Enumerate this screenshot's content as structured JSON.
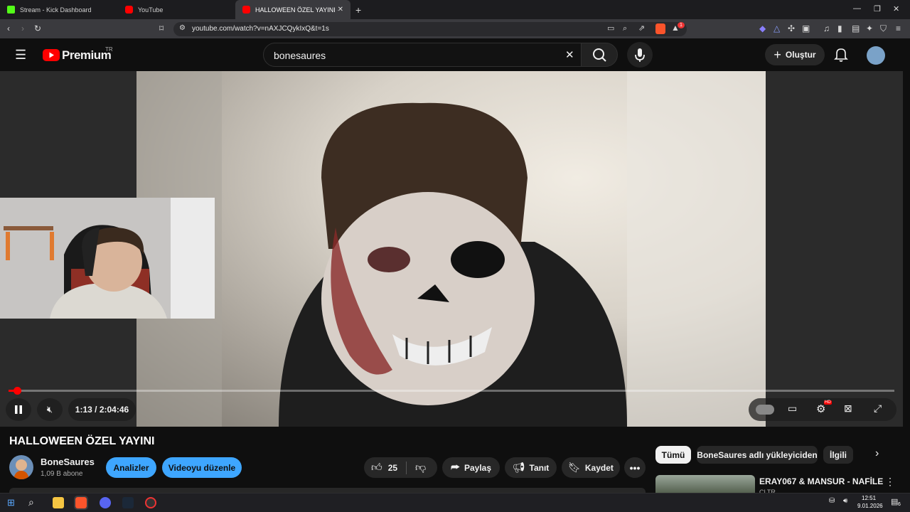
{
  "browser": {
    "tabs": [
      {
        "label": "Stream - Kick Dashboard",
        "active": false
      },
      {
        "label": "YouTube",
        "active": false
      },
      {
        "label": "HALLOWEEN ÖZEL YAYINI - You",
        "active": true
      }
    ],
    "url": "youtube.com/watch?v=nAXJCQykIxQ&t=1s",
    "shield_badge": "1"
  },
  "youtube": {
    "logo_text": "Premium",
    "region": "TR",
    "search_value": "bonesaures",
    "create_label": "Oluştur"
  },
  "player": {
    "time": "1:13 / 2:04:46",
    "progress": 0.01
  },
  "video": {
    "title": "HALLOWEEN ÖZEL YAYINI",
    "channel": "BoneSaures",
    "subscribers": "1,09 B abone",
    "analytics_label": "Analizler",
    "edit_label": "Videoyu düzenle",
    "likes": "25",
    "share_label": "Paylaş",
    "promote_label": "Tanıt",
    "save_label": "Kaydet"
  },
  "chips": [
    "Tümü",
    "BoneSaures adlı yükleyiciden",
    "İlgili"
  ],
  "recommendation": {
    "title": "ERAY067 & MANSUR - NAFİLE",
    "channel": "CLTR"
  },
  "taskbar": {
    "time": "12:51",
    "date": "9.01.2026",
    "notification_count": "6"
  },
  "colors": {
    "accent_red": "#ff0000",
    "button_blue": "#3ea6ff",
    "bg": "#0f0f0f"
  }
}
